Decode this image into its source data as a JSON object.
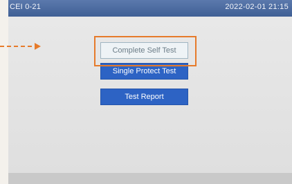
{
  "status_bar": {
    "title": "CEI 0-21",
    "datetime": "2022-02-01  21:15"
  },
  "menu": {
    "complete_self_test": "Complete Self Test",
    "single_protect_test": "Single Protect Test",
    "test_report": "Test Report"
  },
  "colors": {
    "highlight": "#e67a2a",
    "button_blue": "#2d63c4",
    "header_blue": "#4a69a0"
  }
}
